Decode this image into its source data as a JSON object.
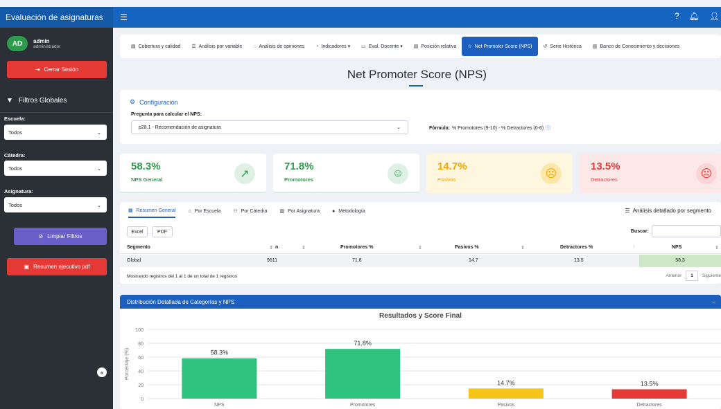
{
  "app": {
    "title": "Evaluación de asignaturas"
  },
  "user": {
    "initials": "AD",
    "name": "admin",
    "role": "administrador"
  },
  "sidebar": {
    "logout_label": "Cerrar Sesión",
    "filters_title": "Filtros Globales",
    "escuela_label": "Escuela:",
    "escuela_value": "Todos",
    "catedra_label": "Cátedra:",
    "catedra_value": "Todos",
    "asignatura_label": "Asignatura:",
    "asignatura_value": "Todos",
    "clear_label": "Limpiar Filtros",
    "pdf_label": "Resumen ejecutivo pdf"
  },
  "tabs": [
    {
      "label": "Cobertura y calidad"
    },
    {
      "label": "Análisis por variable"
    },
    {
      "label": "Análisis de opiniones"
    },
    {
      "label": "Indicadores ▾"
    },
    {
      "label": "Eval. Docente ▾"
    },
    {
      "label": "Posición relativa"
    },
    {
      "label": "Net Promoter Score (NPS)"
    },
    {
      "label": "Serie Histórica"
    },
    {
      "label": "Banco de Conocimiento y decisiones"
    }
  ],
  "page": {
    "title": "Net Promoter Score (NPS)"
  },
  "config": {
    "header": "Configuración",
    "question_label": "Pregunta para calcular el NPS:",
    "question_value": "p28.1 - Recomendación de asignatura",
    "formula_label": "Fórmula:",
    "formula_text": "% Promotores (9-10) - % Detractores (0-6)"
  },
  "kpis": {
    "nps": {
      "value": "58.3%",
      "label": "NPS General",
      "color": "#2e9b4c"
    },
    "promotores": {
      "value": "71.8%",
      "label": "Promotores",
      "color": "#2e9b4c"
    },
    "pasivos": {
      "value": "14.7%",
      "label": "Pasivos",
      "color": "#f0a500"
    },
    "detractores": {
      "value": "13.5%",
      "label": "Detractores",
      "color": "#e53935"
    }
  },
  "table": {
    "subtabs": [
      "Resumen General",
      "Por Escuela",
      "Por Cátedra",
      "Por Asignatura",
      "Metodología"
    ],
    "analysis_label": "Análisis detallado por segmento",
    "excel_label": "Excel",
    "pdf_label": "PDF",
    "search_label": "Buscar:",
    "columns": [
      "Segmento",
      "n",
      "Promotores %",
      "Pasivos %",
      "Detractores %",
      "NPS"
    ],
    "rows": [
      {
        "segmento": "Global",
        "n": "9611",
        "promotores": "71.8",
        "pasivos": "14.7",
        "detractores": "13.5",
        "nps": "58.3"
      }
    ],
    "info": "Mostrando registros del 1 al 1 de un total de 1 registros",
    "prev_label": "Anterior",
    "page": "1",
    "next_label": "Siguiente"
  },
  "chart_card": {
    "header": "Distribución Detallada de Categorías y NPS",
    "minimize": "−"
  },
  "chart_data": {
    "type": "bar",
    "title": "Resultados y Score Final",
    "ylabel": "Porcentaje (%)",
    "xlabel": "",
    "ylim": [
      0,
      100
    ],
    "yticks": [
      0,
      20,
      40,
      60,
      80,
      100
    ],
    "categories": [
      "NPS",
      "Promotores",
      "Pasivos",
      "Detractores"
    ],
    "values": [
      58.3,
      71.8,
      14.7,
      13.5
    ],
    "labels": [
      "58.3%",
      "71.8%",
      "14.7%",
      "13.5%"
    ],
    "colors": [
      "#2ec27e",
      "#2ec27e",
      "#f5c518",
      "#e53935"
    ],
    "grid": true
  }
}
